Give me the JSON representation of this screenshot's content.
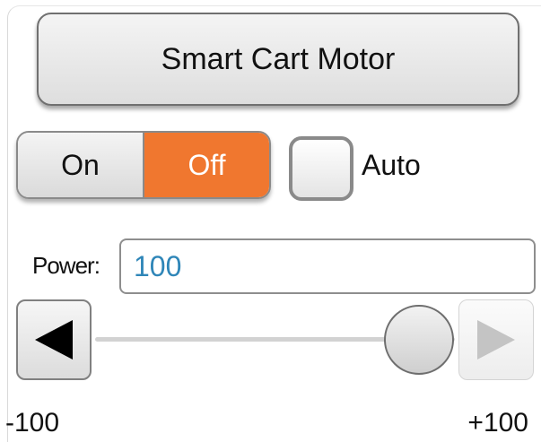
{
  "title_button": {
    "label": "Smart Cart Motor"
  },
  "power_switch": {
    "on_label": "On",
    "off_label": "Off",
    "selected": "Off",
    "selected_color": "#f0772f"
  },
  "auto": {
    "label": "Auto",
    "checked": false
  },
  "power": {
    "label": "Power:",
    "value": "100",
    "value_color": "#2f86b8"
  },
  "slider": {
    "min": -100,
    "max": 100,
    "value": 100,
    "min_label": "-100",
    "max_label": "+100",
    "decrement_icon": "triangle-left-icon",
    "increment_icon": "triangle-right-icon"
  }
}
